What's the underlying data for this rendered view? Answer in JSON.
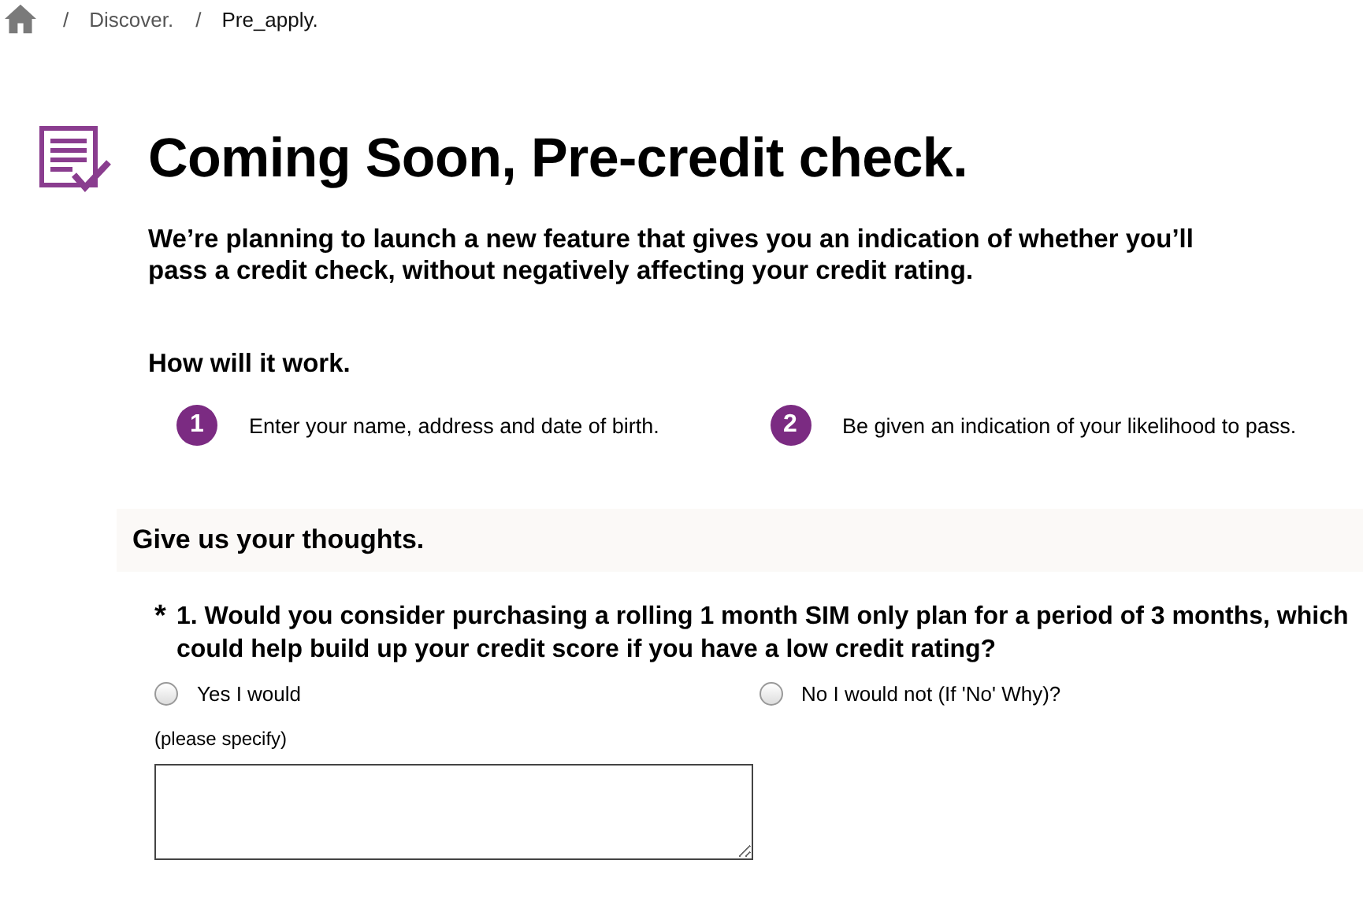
{
  "breadcrumb": [
    "/",
    "Discover.",
    "/",
    "Pre_apply."
  ],
  "title": "Coming Soon, Pre-credit check.",
  "intro": "We’re planning to launch a new feature that gives you an indication of whether you’ll pass a credit check, without negatively affecting your credit rating.",
  "how_heading": "How will it work.",
  "steps": [
    {
      "number": "1",
      "text": "Enter your name, address and date of birth."
    },
    {
      "number": "2",
      "text": "Be given an indication of your likelihood to pass."
    }
  ],
  "feedback": {
    "heading": "Give us your thoughts.",
    "question": {
      "required_mark": "*",
      "text": "1. Would you consider purchasing a rolling 1 month SIM only plan for a period of 3 months, which could help build up your credit score if you have a low credit rating?",
      "options": [
        {
          "label": "Yes I would",
          "selected": false
        },
        {
          "label": "No I would not (If 'No' Why)?",
          "selected": false
        }
      ],
      "specify_label": "(please specify)"
    }
  }
}
